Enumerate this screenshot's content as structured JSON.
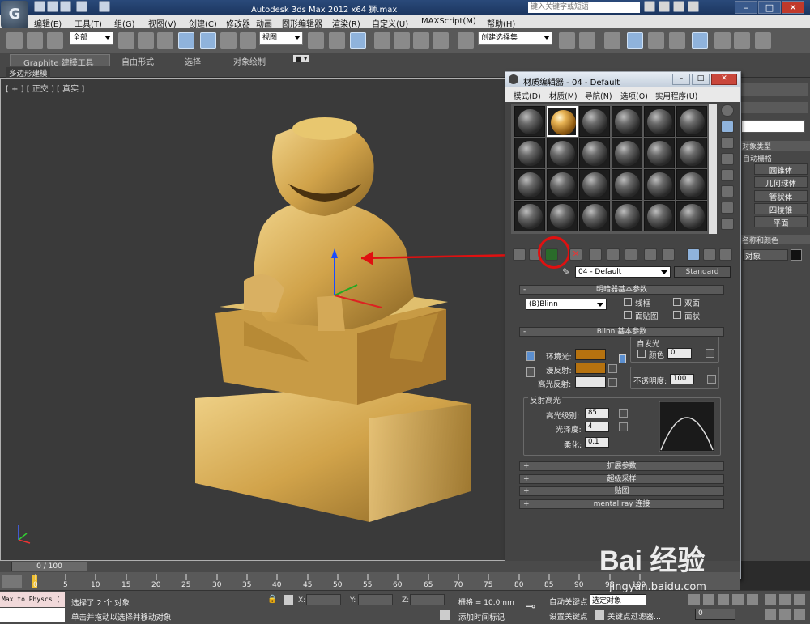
{
  "app": {
    "title": "Autodesk 3ds Max  2012 x64      狮.max",
    "search_placeholder": "键入关键字或短语"
  },
  "menu": [
    "编辑(E)",
    "工具(T)",
    "组(G)",
    "视图(V)",
    "创建(C)",
    "修改器",
    "动画",
    "图形编辑器",
    "渲染(R)",
    "自定义(U)",
    "MAXScript(M)",
    "帮助(H)"
  ],
  "toolbar": {
    "selection_filter": "全部",
    "ref_coord": "视图",
    "named_selection_placeholder": "创建选择集"
  },
  "ribbon": {
    "tabs": [
      "Graphite 建模工具",
      "自由形式",
      "选择",
      "对象绘制"
    ],
    "subtab": "多边形建模"
  },
  "viewport": {
    "label": "[ + ] [ 正交 ] [ 真实 ]"
  },
  "command_panel": {
    "section_object_type": "对象类型",
    "autogrid": "自动栅格",
    "buttons": [
      "圆锥体",
      "几何球体",
      "管状体",
      "四棱锥",
      "平面"
    ],
    "section_name_color": "名称和颜色",
    "object_name": "对象"
  },
  "material_editor": {
    "title": "材质编辑器 - 04 - Default",
    "menu": [
      "模式(D)",
      "材质(M)",
      "导航(N)",
      "选项(O)",
      "实用程序(U)"
    ],
    "material_name": "04 - Default",
    "material_type": "Standard",
    "shader_rollout": "明暗器基本参数",
    "shader": "(B)Blinn",
    "shader_checkboxes": [
      "线框",
      "双面",
      "面贴图",
      "面状"
    ],
    "blinn_rollout": "Blinn 基本参数",
    "self_illum": {
      "title": "自发光",
      "color_label": "颜色",
      "value": "0"
    },
    "ambient_label": "环境光:",
    "diffuse_label": "漫反射:",
    "specular_label": "高光反射:",
    "opacity_label": "不透明度:",
    "opacity_value": "100",
    "specular_highlights": {
      "title": "反射高光",
      "level_label": "高光级别:",
      "level": "85",
      "gloss_label": "光泽度:",
      "gloss": "4",
      "soften_label": "柔化:",
      "soften": "0.1"
    },
    "rollouts": [
      "扩展参数",
      "超级采样",
      "贴图",
      "mental ray 连接"
    ],
    "colors": {
      "ambient": "#b6720f",
      "diffuse": "#b6720f",
      "specular": "#e5e5e5"
    }
  },
  "timeline": {
    "frame_display": "0 / 100",
    "ticks": [
      "0",
      "5",
      "10",
      "15",
      "20",
      "25",
      "30",
      "35",
      "40",
      "45",
      "50",
      "55",
      "60",
      "65",
      "70",
      "75",
      "80",
      "85",
      "90",
      "95",
      "100"
    ]
  },
  "status": {
    "maxscript_text": "Max to Physcs (",
    "selected": "选择了 2 个 对象",
    "prompt": "单击并拖动以选择并移动对象",
    "x_label": "X:",
    "y_label": "Y:",
    "z_label": "Z:",
    "grid": "栅格 = 10.0mm",
    "add_time_tag": "添加时间标记",
    "auto_key": "自动关键点",
    "set_key": "设置关键点",
    "selected_set": "选定对象",
    "key_filters": "关键点过滤器...",
    "frame": "0"
  },
  "watermark": {
    "text": "Bai 经验",
    "url": "jingyan.baidu.com"
  }
}
